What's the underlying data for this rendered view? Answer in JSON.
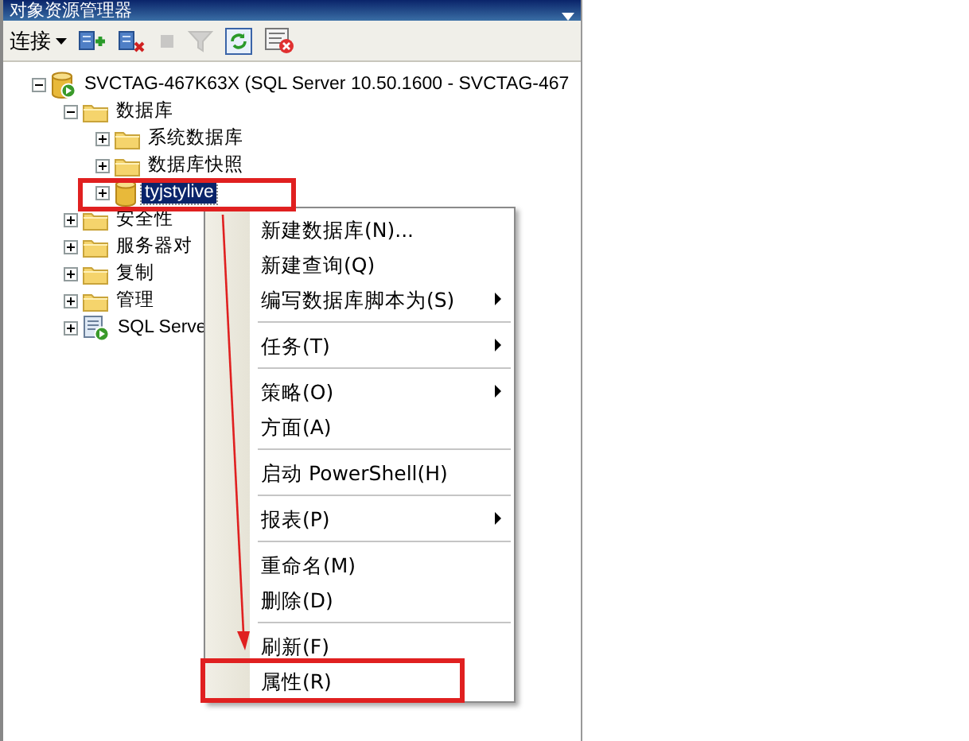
{
  "panel": {
    "title": "对象资源管理器"
  },
  "toolbar": {
    "connect_label": "连接",
    "buttons": [
      {
        "kind": "connect",
        "disabled": false
      },
      {
        "kind": "disconnect",
        "disabled": false
      },
      {
        "kind": "stop",
        "disabled": true
      },
      {
        "kind": "filter",
        "disabled": true
      },
      {
        "kind": "refresh",
        "disabled": false
      },
      {
        "kind": "activity",
        "disabled": false
      }
    ]
  },
  "tree": [
    {
      "label": "SVCTAG-467K63X (SQL Server 10.50.1600 - SVCTAG-467",
      "kind": "server",
      "expanded": true,
      "selected": false,
      "children": [
        {
          "label": "数据库",
          "kind": "folder",
          "expanded": true,
          "selected": false,
          "children": [
            {
              "label": "系统数据库",
              "kind": "folder",
              "expanded": false,
              "selected": false
            },
            {
              "label": "数据库快照",
              "kind": "folder",
              "expanded": false,
              "selected": false
            },
            {
              "label": "tyjstylive",
              "kind": "database",
              "expanded": false,
              "selected": true
            }
          ]
        },
        {
          "label": "安全性",
          "kind": "folder",
          "expanded": false,
          "selected": false
        },
        {
          "label": "服务器对",
          "kind": "folder",
          "expanded": false,
          "selected": false
        },
        {
          "label": "复制",
          "kind": "folder",
          "expanded": false,
          "selected": false
        },
        {
          "label": "管理",
          "kind": "folder",
          "expanded": false,
          "selected": false
        },
        {
          "label": "SQL Serve",
          "kind": "agent",
          "expanded": false,
          "selected": false
        }
      ]
    }
  ],
  "context_menu": [
    {
      "kind": "item",
      "label": "新建数据库(N)...",
      "submenu": false
    },
    {
      "kind": "item",
      "label": "新建查询(Q)",
      "submenu": false
    },
    {
      "kind": "item",
      "label": "编写数据库脚本为(S)",
      "submenu": true
    },
    {
      "kind": "separator"
    },
    {
      "kind": "item",
      "label": "任务(T)",
      "submenu": true
    },
    {
      "kind": "separator"
    },
    {
      "kind": "item",
      "label": "策略(O)",
      "submenu": true
    },
    {
      "kind": "item",
      "label": "方面(A)",
      "submenu": false
    },
    {
      "kind": "separator"
    },
    {
      "kind": "item",
      "label": "启动 PowerShell(H)",
      "submenu": false
    },
    {
      "kind": "separator"
    },
    {
      "kind": "item",
      "label": "报表(P)",
      "submenu": true
    },
    {
      "kind": "separator"
    },
    {
      "kind": "item",
      "label": "重命名(M)",
      "submenu": false
    },
    {
      "kind": "item",
      "label": "删除(D)",
      "submenu": false
    },
    {
      "kind": "separator"
    },
    {
      "kind": "item",
      "label": "刷新(F)",
      "submenu": false
    },
    {
      "kind": "item",
      "label": "属性(R)",
      "submenu": false
    }
  ]
}
